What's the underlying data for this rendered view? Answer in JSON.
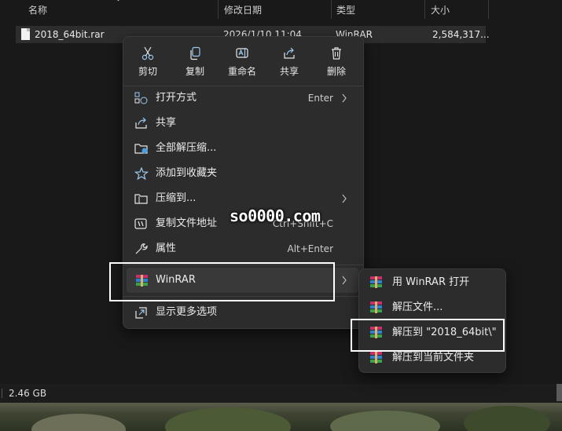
{
  "header": {
    "columns": [
      {
        "label": "名称"
      },
      {
        "label": "修改日期"
      },
      {
        "label": "类型"
      },
      {
        "label": "大小"
      }
    ]
  },
  "file": {
    "name": "2018_64bit.rar",
    "modified": "2026/1/10 11:04",
    "type": "WinRAR",
    "size": "2,584,317..."
  },
  "menu": {
    "quick_actions": [
      {
        "label": "剪切",
        "icon": "scissors-icon"
      },
      {
        "label": "复制",
        "icon": "copy-icon"
      },
      {
        "label": "重命名",
        "icon": "rename-icon"
      },
      {
        "label": "共享",
        "icon": "share-icon"
      },
      {
        "label": "删除",
        "icon": "trash-icon"
      }
    ],
    "items": [
      {
        "label": "打开方式",
        "shortcut": "Enter",
        "submenu": true
      },
      {
        "label": "共享",
        "shortcut": ""
      },
      {
        "label": "全部解压缩...",
        "shortcut": ""
      },
      {
        "label": "添加到收藏夹",
        "shortcut": ""
      },
      {
        "label": "压缩到...",
        "shortcut": "",
        "submenu": true
      },
      {
        "label": "复制文件地址",
        "shortcut": "Ctrl+Shift+C"
      },
      {
        "label": "属性",
        "shortcut": "Alt+Enter"
      },
      {
        "label": "WinRAR",
        "shortcut": "",
        "submenu": true
      },
      {
        "label": "显示更多选项",
        "shortcut": ""
      }
    ]
  },
  "submenu": {
    "items": [
      {
        "label": "用 WinRAR 打开"
      },
      {
        "label": "解压文件..."
      },
      {
        "label": "解压到 \"2018_64bit\\\""
      },
      {
        "label": "解压到当前文件夹"
      }
    ]
  },
  "status": {
    "selection_size": "2.46 GB"
  },
  "watermark": "so0000.com",
  "colors": {
    "menu_bg": "#2c2c2c",
    "highlight": "#393939",
    "annotation_box": "#ffffff"
  }
}
